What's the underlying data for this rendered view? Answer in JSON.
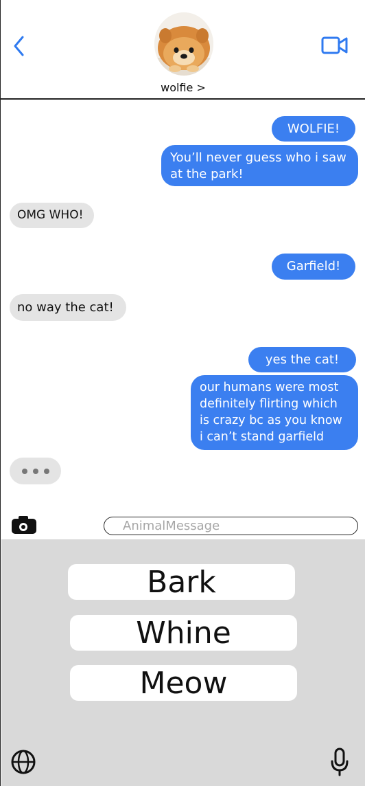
{
  "header": {
    "contact_name": "wolfie >",
    "icons": {
      "back": "chevron-left-icon",
      "video": "video-camera-icon",
      "avatar": "pomeranian-dog-avatar"
    }
  },
  "messages": [
    {
      "direction": "outgoing",
      "text": "WOLFIE!"
    },
    {
      "direction": "outgoing",
      "text": "You’ll never guess who i saw at the park!"
    },
    {
      "direction": "incoming",
      "text": "OMG WHO!"
    },
    {
      "direction": "outgoing",
      "text": "Garfield!"
    },
    {
      "direction": "incoming",
      "text": "no way the cat!"
    },
    {
      "direction": "outgoing",
      "text": "yes the cat!"
    },
    {
      "direction": "outgoing",
      "text": "our humans were most definitely flirting which is crazy bc as you know i can’t stand garfield"
    }
  ],
  "compose": {
    "placeholder": "AnimalMessage",
    "icons": {
      "camera": "camera-icon"
    }
  },
  "keyboard": {
    "keys": [
      {
        "label": "Bark"
      },
      {
        "label": "Whine"
      },
      {
        "label": "Meow"
      }
    ],
    "icons": {
      "globe": "globe-icon",
      "mic": "microphone-icon"
    }
  },
  "colors": {
    "outgoing_bubble": "#3b7ff0",
    "incoming_bubble": "#e4e4e4",
    "accent": "#2f7af0",
    "keyboard_bg": "#d9d9d9"
  }
}
